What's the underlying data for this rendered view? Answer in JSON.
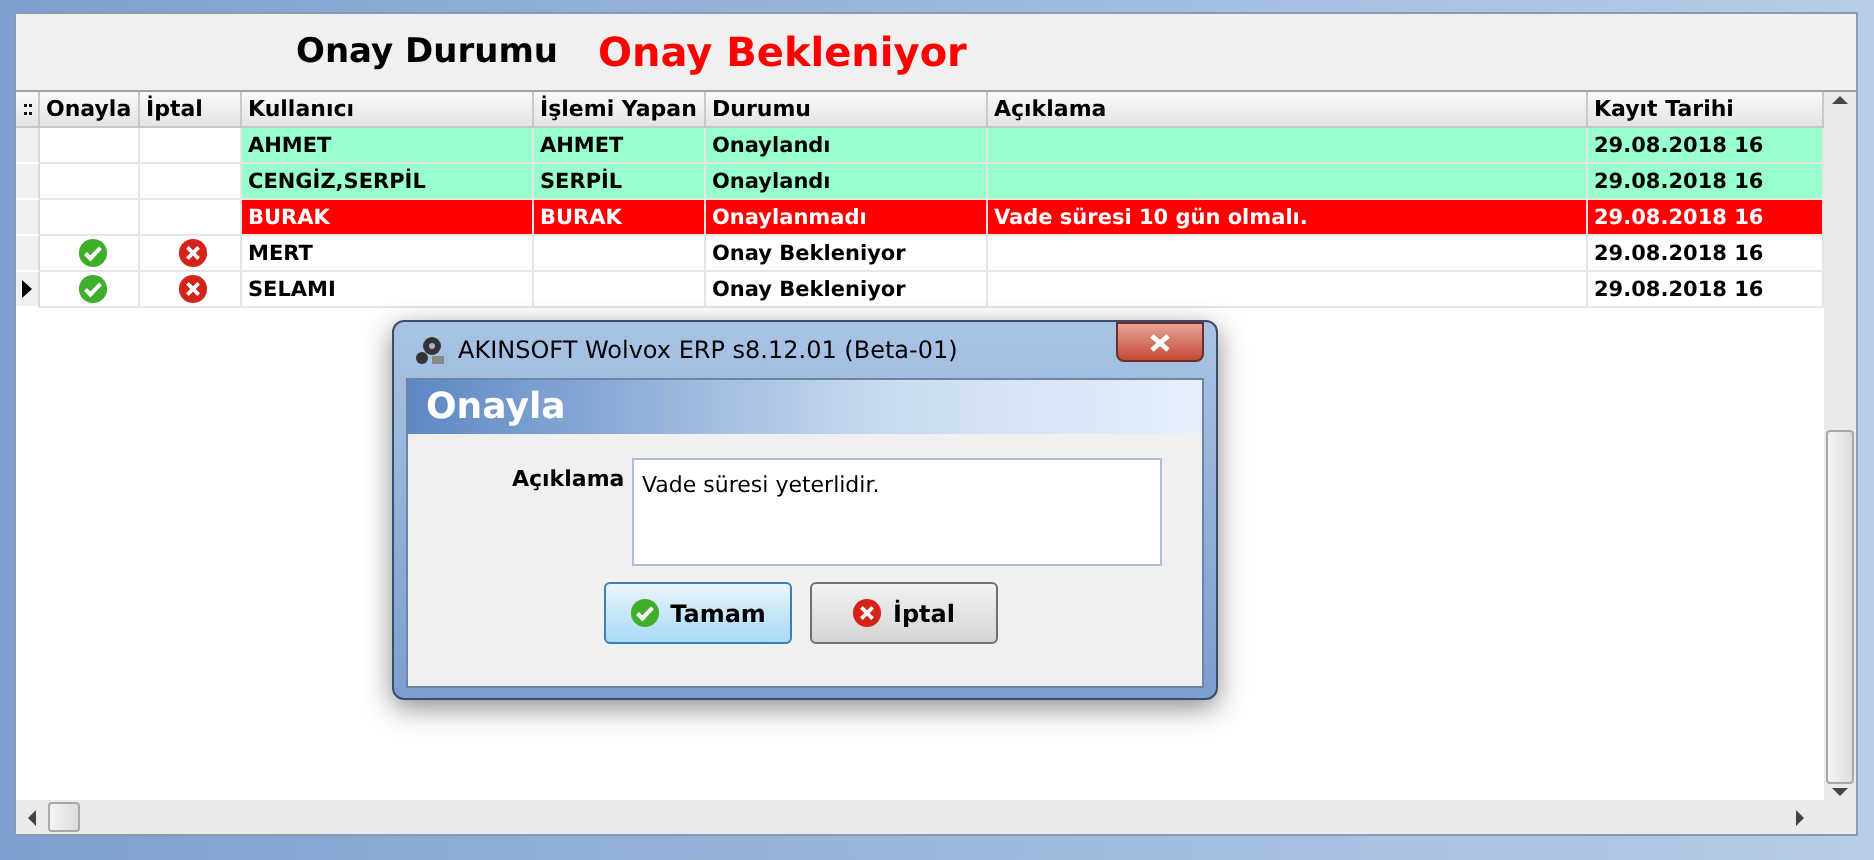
{
  "header": {
    "label": "Onay Durumu",
    "value": "Onay Bekleniyor"
  },
  "table": {
    "columns": [
      "Onayla",
      "İptal",
      "Kullanıcı",
      "İşlemi Yapan",
      "Durumu",
      "Açıklama",
      "Kayıt Tarihi"
    ],
    "rows": [
      {
        "kind": "approved",
        "selected": false,
        "user": "AHMET",
        "operator": "AHMET",
        "status": "Onaylandı",
        "note": "",
        "date": "29.08.2018 16"
      },
      {
        "kind": "approved",
        "selected": false,
        "user": "CENGİZ,SERPİL",
        "operator": "SERPİL",
        "status": "Onaylandı",
        "note": "",
        "date": "29.08.2018 16"
      },
      {
        "kind": "rejected",
        "selected": false,
        "user": "BURAK",
        "operator": "BURAK",
        "status": "Onaylanmadı",
        "note": "Vade süresi 10 gün olmalı.",
        "date": "29.08.2018 16"
      },
      {
        "kind": "pending",
        "selected": false,
        "user": "MERT",
        "operator": "",
        "status": "Onay Bekleniyor",
        "note": "",
        "date": "29.08.2018 16"
      },
      {
        "kind": "pending",
        "selected": true,
        "user": "SELAMI",
        "operator": "",
        "status": "Onay Bekleniyor",
        "note": "",
        "date": "29.08.2018 16"
      }
    ]
  },
  "dialog": {
    "title": "AKINSOFT Wolvox ERP s8.12.01 (Beta-01)",
    "heading": "Onayla",
    "field_label": "Açıklama",
    "field_value": "Vade süresi yeterlidir.",
    "buttons": [
      {
        "kind": "ok",
        "label": "Tamam"
      },
      {
        "kind": "cancel",
        "label": "İptal"
      }
    ]
  }
}
